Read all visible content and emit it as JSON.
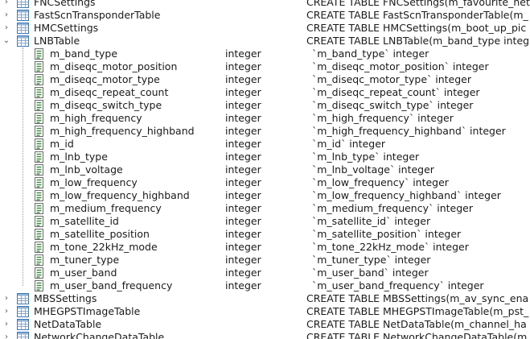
{
  "icons": {
    "table": "table-icon",
    "column": "column-icon"
  },
  "colors": {
    "table_icon_blue": "#3a76b8",
    "column_icon_green": "#3c8a3c"
  },
  "rows": [
    {
      "kind": "table",
      "expander": "collapsed",
      "name": "FNCSettings",
      "type": "",
      "schema": "CREATE TABLE FNCSettings(m_favourite_net"
    },
    {
      "kind": "table",
      "expander": "collapsed",
      "name": "FastScnTransponderTable",
      "type": "",
      "schema": "CREATE TABLE FastScnTransponderTable(m_"
    },
    {
      "kind": "table",
      "expander": "collapsed",
      "name": "HMCSettings",
      "type": "",
      "schema": "CREATE TABLE HMCSettings(m_boot_up_pic"
    },
    {
      "kind": "table",
      "expander": "expanded",
      "name": "LNBTable",
      "type": "",
      "schema": "CREATE TABLE LNBTable(m_band_type integ"
    },
    {
      "kind": "column",
      "name": "m_band_type",
      "type": "integer",
      "schema": "`m_band_type` integer"
    },
    {
      "kind": "column",
      "name": "m_diseqc_motor_position",
      "type": "integer",
      "schema": "`m_diseqc_motor_position` integer"
    },
    {
      "kind": "column",
      "name": "m_diseqc_motor_type",
      "type": "integer",
      "schema": "`m_diseqc_motor_type` integer"
    },
    {
      "kind": "column",
      "name": "m_diseqc_repeat_count",
      "type": "integer",
      "schema": "`m_diseqc_repeat_count` integer"
    },
    {
      "kind": "column",
      "name": "m_diseqc_switch_type",
      "type": "integer",
      "schema": "`m_diseqc_switch_type` integer"
    },
    {
      "kind": "column",
      "name": "m_high_frequency",
      "type": "integer",
      "schema": "`m_high_frequency` integer"
    },
    {
      "kind": "column",
      "name": "m_high_frequency_highband",
      "type": "integer",
      "schema": "`m_high_frequency_highband` integer"
    },
    {
      "kind": "column",
      "name": "m_id",
      "type": "integer",
      "schema": "`m_id` integer"
    },
    {
      "kind": "column",
      "name": "m_lnb_type",
      "type": "integer",
      "schema": "`m_lnb_type` integer"
    },
    {
      "kind": "column",
      "name": "m_lnb_voltage",
      "type": "integer",
      "schema": "`m_lnb_voltage` integer"
    },
    {
      "kind": "column",
      "name": "m_low_frequency",
      "type": "integer",
      "schema": "`m_low_frequency` integer"
    },
    {
      "kind": "column",
      "name": "m_low_frequency_highband",
      "type": "integer",
      "schema": "`m_low_frequency_highband` integer"
    },
    {
      "kind": "column",
      "name": "m_medium_frequency",
      "type": "integer",
      "schema": "`m_medium_frequency` integer"
    },
    {
      "kind": "column",
      "name": "m_satellite_id",
      "type": "integer",
      "schema": "`m_satellite_id` integer"
    },
    {
      "kind": "column",
      "name": "m_satellite_position",
      "type": "integer",
      "schema": "`m_satellite_position` integer"
    },
    {
      "kind": "column",
      "name": "m_tone_22kHz_mode",
      "type": "integer",
      "schema": "`m_tone_22kHz_mode` integer"
    },
    {
      "kind": "column",
      "name": "m_tuner_type",
      "type": "integer",
      "schema": "`m_tuner_type` integer"
    },
    {
      "kind": "column",
      "name": "m_user_band",
      "type": "integer",
      "schema": "`m_user_band` integer"
    },
    {
      "kind": "column",
      "name": "m_user_band_frequency",
      "type": "integer",
      "schema": "`m_user_band_frequency` integer"
    },
    {
      "kind": "table",
      "expander": "collapsed",
      "name": "MBSSettings",
      "type": "",
      "schema": "CREATE TABLE MBSSettings(m_av_sync_ena"
    },
    {
      "kind": "table",
      "expander": "collapsed",
      "name": "MHEGPSTImageTable",
      "type": "",
      "schema": "CREATE TABLE MHEGPSTImageTable(m_pst_"
    },
    {
      "kind": "table",
      "expander": "collapsed",
      "name": "NetDataTable",
      "type": "",
      "schema": "CREATE TABLE NetDataTable(m_channel_ha"
    },
    {
      "kind": "table",
      "expander": "collapsed",
      "name": "NetworkChangeDataTable",
      "type": "",
      "schema": "CREATE TABLE NetworkChangeDataTable(m_"
    }
  ]
}
